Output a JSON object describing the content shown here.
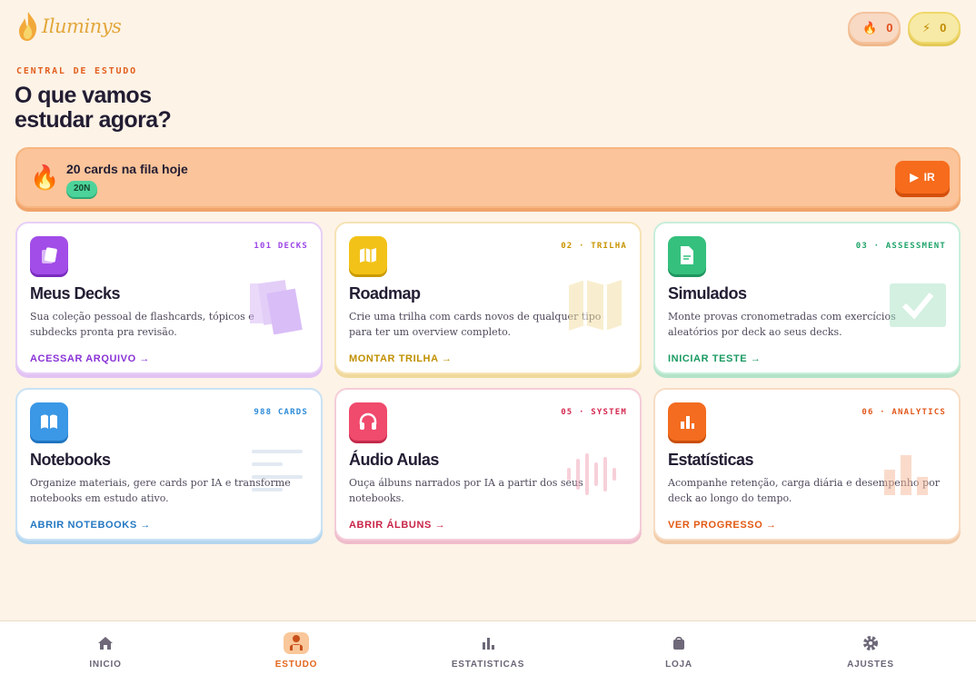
{
  "brand": {
    "name": "Iluminys"
  },
  "stats": {
    "streak": "0",
    "energy": "0"
  },
  "hero": {
    "eyebrow": "CENTRAL DE ESTUDO",
    "headline_line1": "O que vamos",
    "headline_line2": "estudar agora?"
  },
  "queue": {
    "title": "20 cards na fila hoje",
    "badge": "20N",
    "button_label": "IR"
  },
  "cards": [
    {
      "tag": "101 DECKS",
      "title": "Meus Decks",
      "desc": "Sua coleção pessoal de flashcards, tópicos e subdecks pronta pra revisão.",
      "cta": "ACESSAR ARQUIVO →",
      "icon": "decks-icon",
      "color": "#9b45e6"
    },
    {
      "tag": "02 · TRILHA",
      "title": "Roadmap",
      "desc": "Crie uma trilha com cards novos de qualquer tipo para ter um overview completo.",
      "cta": "MONTAR TRILHA →",
      "icon": "map-icon",
      "color": "#d9a108"
    },
    {
      "tag": "03 · ASSESSMENT",
      "title": "Simulados",
      "desc": "Monte provas cronometradas com exercícios aleatórios por deck ao seus decks.",
      "cta": "INICIAR TESTE →",
      "icon": "document-icon",
      "color": "#1fa36a"
    },
    {
      "tag": "988 CARDS",
      "title": "Notebooks",
      "desc": "Organize materiais, gere cards por IA e transforme notebooks em estudo ativo.",
      "cta": "ABRIR NOTEBOOKS →",
      "icon": "book-icon",
      "color": "#2b8ad8"
    },
    {
      "tag": "05 · SYSTEM",
      "title": "Áudio Aulas",
      "desc": "Ouça álbuns narrados por IA a partir dos seus notebooks.",
      "cta": "ABRIR ÁLBUNS →",
      "icon": "headphones-icon",
      "color": "#d4284f"
    },
    {
      "tag": "06 · ANALYTICS",
      "title": "Estatísticas",
      "desc": "Acompanhe retenção, carga diária e desempenho por deck ao longo do tempo.",
      "cta": "VER PROGRESSO →",
      "icon": "bar-chart-icon",
      "color": "#ea5f14"
    }
  ],
  "nav": [
    {
      "label": "INICIO",
      "icon": "home-icon"
    },
    {
      "label": "ESTUDO",
      "icon": "study-icon",
      "active": true
    },
    {
      "label": "ESTATISTICAS",
      "icon": "stats-icon"
    },
    {
      "label": "LOJA",
      "icon": "shop-icon"
    },
    {
      "label": "AJUSTES",
      "icon": "settings-icon"
    }
  ]
}
